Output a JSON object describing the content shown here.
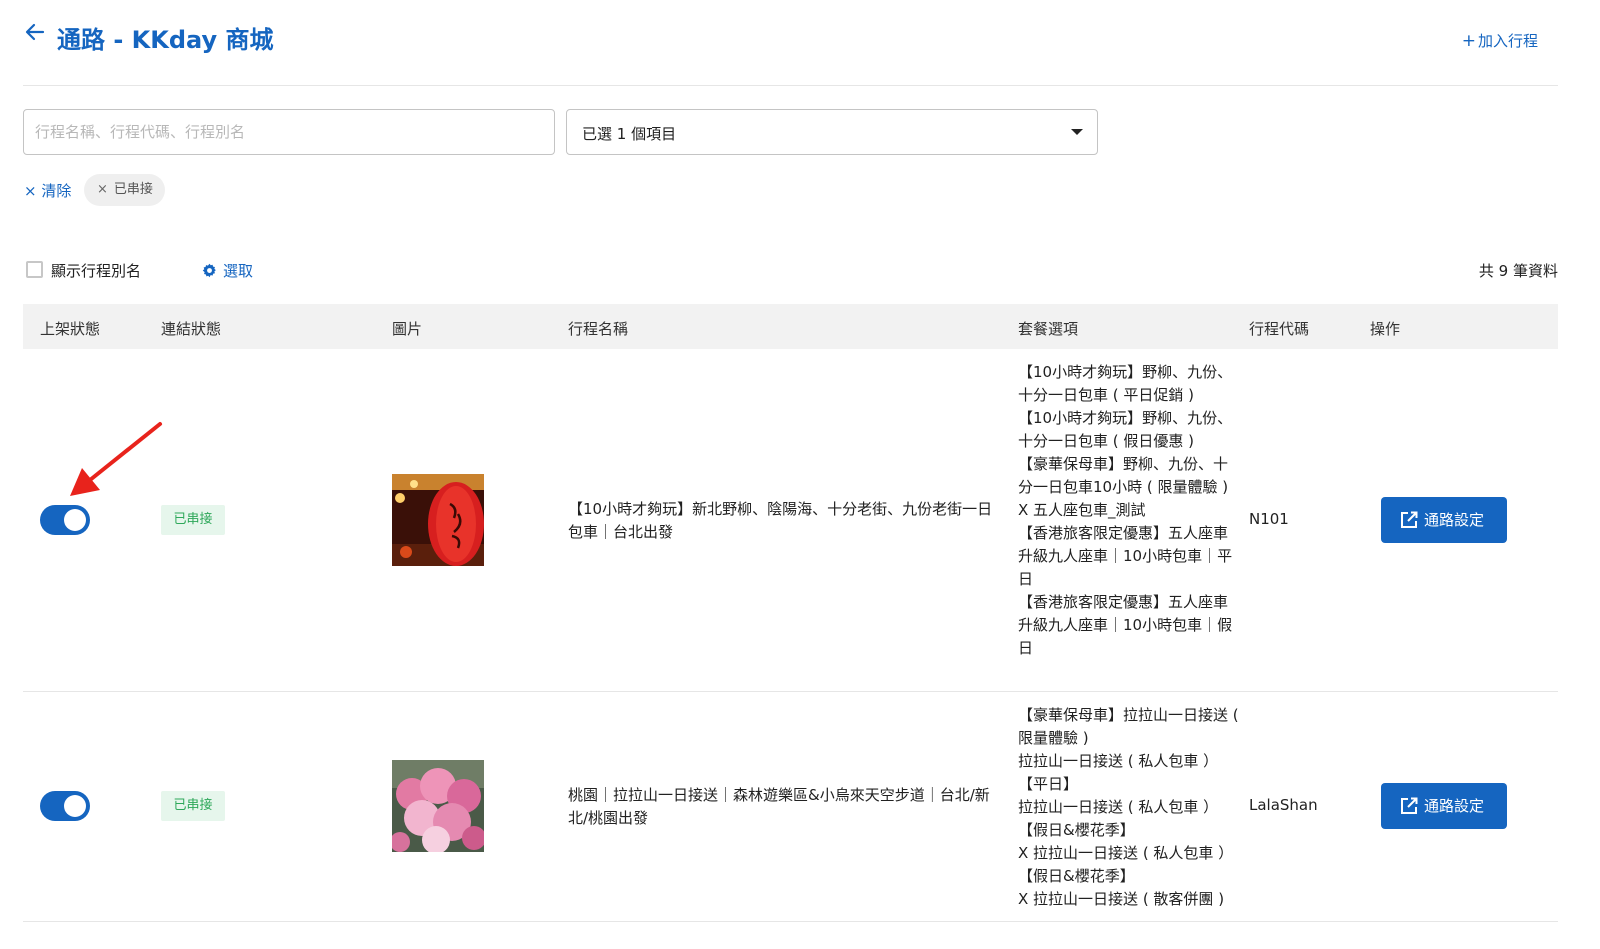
{
  "header": {
    "title": "通路  - KKday 商城",
    "add_trip": "加入行程"
  },
  "filters": {
    "search_placeholder": "行程名稱、行程代碼、行程別名",
    "selected_label": "已選 1 個項目",
    "clear_label": "清除",
    "chip_label": "已串接"
  },
  "toolbar": {
    "show_alias_label": "顯示行程別名",
    "select_columns_label": "選取",
    "total_count": "共 9 筆資料"
  },
  "table": {
    "headers": [
      "上架狀態",
      "連結狀態",
      "圖片",
      "行程名稱",
      "套餐選項",
      "行程代碼",
      "操作"
    ],
    "rows": [
      {
        "listed": true,
        "link_status": "已串接",
        "image_icon": "lantern-photo",
        "name": "【10小時才夠玩】新北野柳、陰陽海、十分老街、九份老街一日包車｜台北出發",
        "options": [
          "【10小時才夠玩】野柳、九份、十分一日包車 ( 平日促銷 )",
          "【10小時才夠玩】野柳、九份、十分一日包車 ( 假日優惠 )",
          "【豪華保母車】野柳、九份、十分一日包車10小時 ( 限量體驗 )",
          "X 五人座包車_測試",
          "【香港旅客限定優惠】五人座車升級九人座車｜10小時包車｜平日",
          "【香港旅客限定優惠】五人座車升級九人座車｜10小時包車｜假日"
        ],
        "code": "N101",
        "action_label": "通路設定"
      },
      {
        "listed": true,
        "link_status": "已串接",
        "image_icon": "cherry-blossom-photo",
        "name": "桃園｜拉拉山一日接送｜森林遊樂區&小烏來天空步道｜台北/新北/桃園出發",
        "options": [
          "【豪華保母車】拉拉山一日接送 ( 限量體驗 )",
          "拉拉山一日接送 ( 私人包車 ）【平日】",
          "拉拉山一日接送 ( 私人包車 ）【假日&櫻花季】",
          "X 拉拉山一日接送 ( 私人包車 ）【假日&櫻花季】",
          "X 拉拉山一日接送 ( 散客併團 )"
        ],
        "code": "LalaShan",
        "action_label": "通路設定"
      }
    ]
  },
  "colors": {
    "primary": "#1565c0",
    "badge_bg": "#e6f6ec",
    "badge_text": "#2ea85a",
    "annotation": "#e8231c"
  }
}
